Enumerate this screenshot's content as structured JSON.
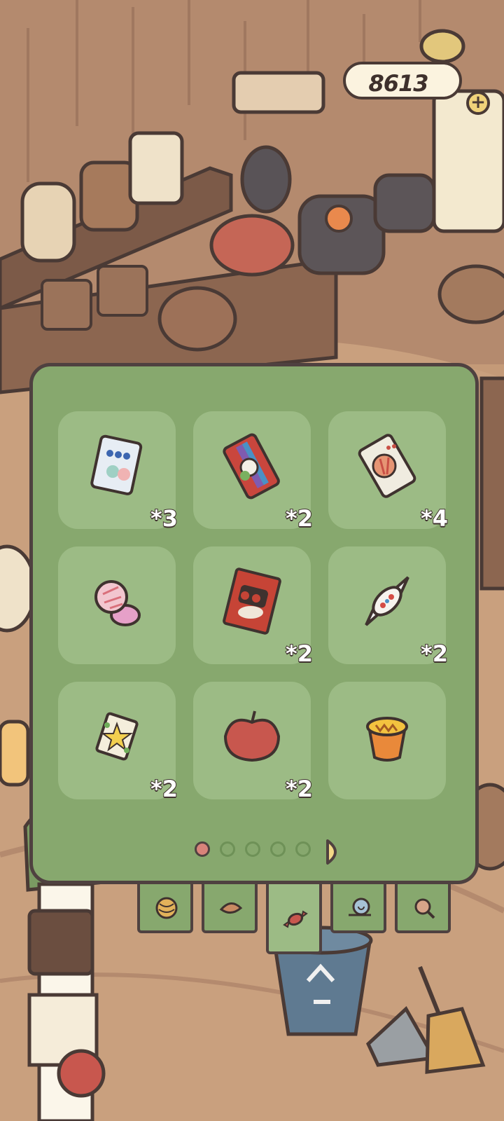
{
  "currency": {
    "amount": "8613",
    "add_label": "+"
  },
  "inventory": {
    "items": [
      {
        "name": "gummy-pack",
        "count": "*3",
        "icon": "gummy-pack-icon"
      },
      {
        "name": "rainbow-chips",
        "count": "*2",
        "icon": "rainbow-chips-icon"
      },
      {
        "name": "melon-candy",
        "count": "*4",
        "icon": "melon-candy-icon"
      },
      {
        "name": "pacifier-lollipop",
        "count": "",
        "icon": "pacifier-candy-icon"
      },
      {
        "name": "red-snack-bag",
        "count": "*2",
        "icon": "snack-bag-icon"
      },
      {
        "name": "wrapped-candy",
        "count": "*2",
        "icon": "wrapped-candy-icon"
      },
      {
        "name": "star-candy",
        "count": "*2",
        "icon": "star-candy-icon"
      },
      {
        "name": "apple",
        "count": "*2",
        "icon": "apple-icon"
      },
      {
        "name": "pudding-cup",
        "count": "",
        "icon": "pudding-icon"
      }
    ],
    "page": {
      "current": 1,
      "total": 5
    }
  },
  "tabs": [
    {
      "name": "yarn",
      "icon": "yarn-ball-icon",
      "active": false
    },
    {
      "name": "leaf",
      "icon": "leaf-icon",
      "active": false
    },
    {
      "name": "candy",
      "icon": "candy-icon",
      "active": true
    },
    {
      "name": "snail",
      "icon": "snail-icon",
      "active": false
    },
    {
      "name": "search",
      "icon": "magnifier-icon",
      "active": false
    }
  ],
  "colors": {
    "panel": "#87a86e",
    "slot": "#9cbb85",
    "outline": "#4f4140",
    "active_dot": "#d8837a",
    "room_floor": "#c49a78"
  }
}
